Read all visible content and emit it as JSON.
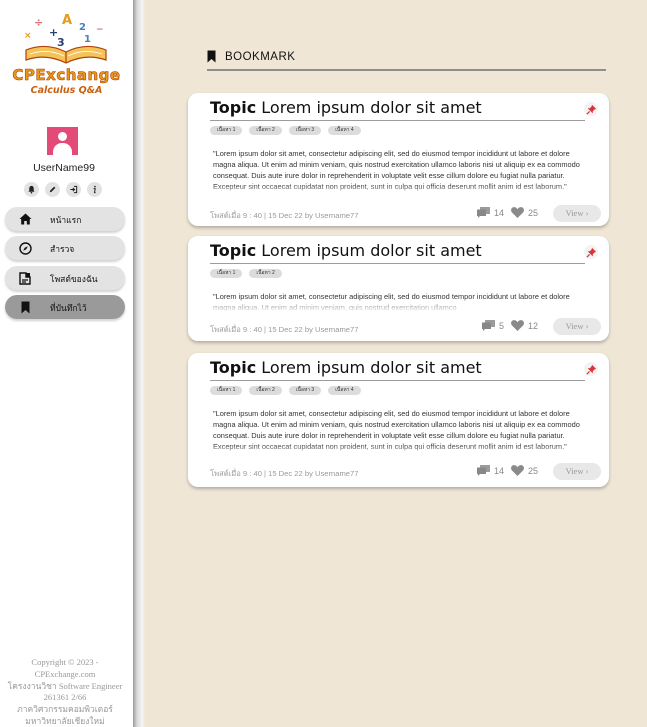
{
  "brand": {
    "name": "CPExchange",
    "subtitle": "Calculus Q&A",
    "colors": {
      "primary": "#e79a16",
      "dark": "#b0420c"
    }
  },
  "user": {
    "username": "UserName99",
    "avatar_color": "#e24a77"
  },
  "quick_actions": [
    {
      "icon": "bell-icon"
    },
    {
      "icon": "pencil-icon"
    },
    {
      "icon": "logout-icon"
    },
    {
      "icon": "info-icon"
    }
  ],
  "nav": [
    {
      "icon": "home-icon",
      "label": "หน้าแรก",
      "active": false
    },
    {
      "icon": "compass-icon",
      "label": "สำรวจ",
      "active": false
    },
    {
      "icon": "my-posts-icon",
      "label": "โพสต์ของฉัน",
      "active": false
    },
    {
      "icon": "bookmark-icon",
      "label": "ที่บันทึกไว้",
      "active": true
    }
  ],
  "footer": [
    "Copyright © 2023 -",
    "CPExchange.com",
    "โครงงานวิชา Software Engineer",
    "261361 2/66",
    "ภาควิศวกรรมคอมพิวเตอร์",
    "มหาวิทยาลัยเชียงใหม่"
  ],
  "section": {
    "title": "BOOKMARK",
    "icon": "bookmark-icon"
  },
  "posts": [
    {
      "topic": "Topic",
      "title": "Lorem ipsum dolor sit amet",
      "tags": [
        "เนื้อหา 1",
        "เนื้อหา 2",
        "เนื้อหา 3",
        "เนื้อหา 4"
      ],
      "excerpt": "\"Lorem ipsum dolor sit amet, consectetur adipiscing elit, sed do eiusmod tempor incididunt ut labore et dolore magna aliqua. Ut enim ad minim veniam, quis nostrud exercitation ullamco laboris nisi ut aliquip ex ea commodo consequat. Duis aute irure dolor in reprehenderit in voluptate velit esse cillum dolore eu fugiat nulla pariatur. Excepteur sint occaecat cupidatat non proident, sunt in culpa qui officia deserunt mollit anim id est laborum.\"",
      "meta": "โพสต์เมื่อ 9 : 40 | 15 Dec 22 by Username77",
      "comments": "14",
      "likes": "25",
      "view_label": "View ›"
    },
    {
      "topic": "Topic",
      "title": "Lorem ipsum dolor sit amet",
      "tags": [
        "เนื้อหา 1",
        "เนื้อหา 2"
      ],
      "excerpt": "\"Lorem ipsum dolor sit amet, consectetur adipiscing elit, sed do eiusmod tempor incididunt ut labore et dolore magna aliqua. Ut enim ad minim veniam, quis nostrud exercitation ullamco",
      "meta": "โพสต์เมื่อ 9 : 40 | 15 Dec 22 by Username77",
      "comments": "5",
      "likes": "12",
      "view_label": "View ›"
    },
    {
      "topic": "Topic",
      "title": "Lorem ipsum dolor sit amet",
      "tags": [
        "เนื้อหา 1",
        "เนื้อหา 2",
        "เนื้อหา 3",
        "เนื้อหา 4"
      ],
      "excerpt": "\"Lorem ipsum dolor sit amet, consectetur adipiscing elit, sed do eiusmod tempor incididunt ut labore et dolore magna aliqua. Ut enim ad minim veniam, quis nostrud exercitation ullamco laboris nisi ut aliquip ex ea commodo consequat. Duis aute irure dolor in reprehenderit in voluptate velit esse cillum dolore eu fugiat nulla pariatur. Excepteur sint occaecat cupidatat non proident, sunt in culpa qui officia deserunt mollit anim id est laborum.\"",
      "meta": "โพสต์เมื่อ 9 : 40 | 15 Dec 22 by Username77",
      "comments": "14",
      "likes": "25",
      "view_label": "View ›"
    }
  ]
}
